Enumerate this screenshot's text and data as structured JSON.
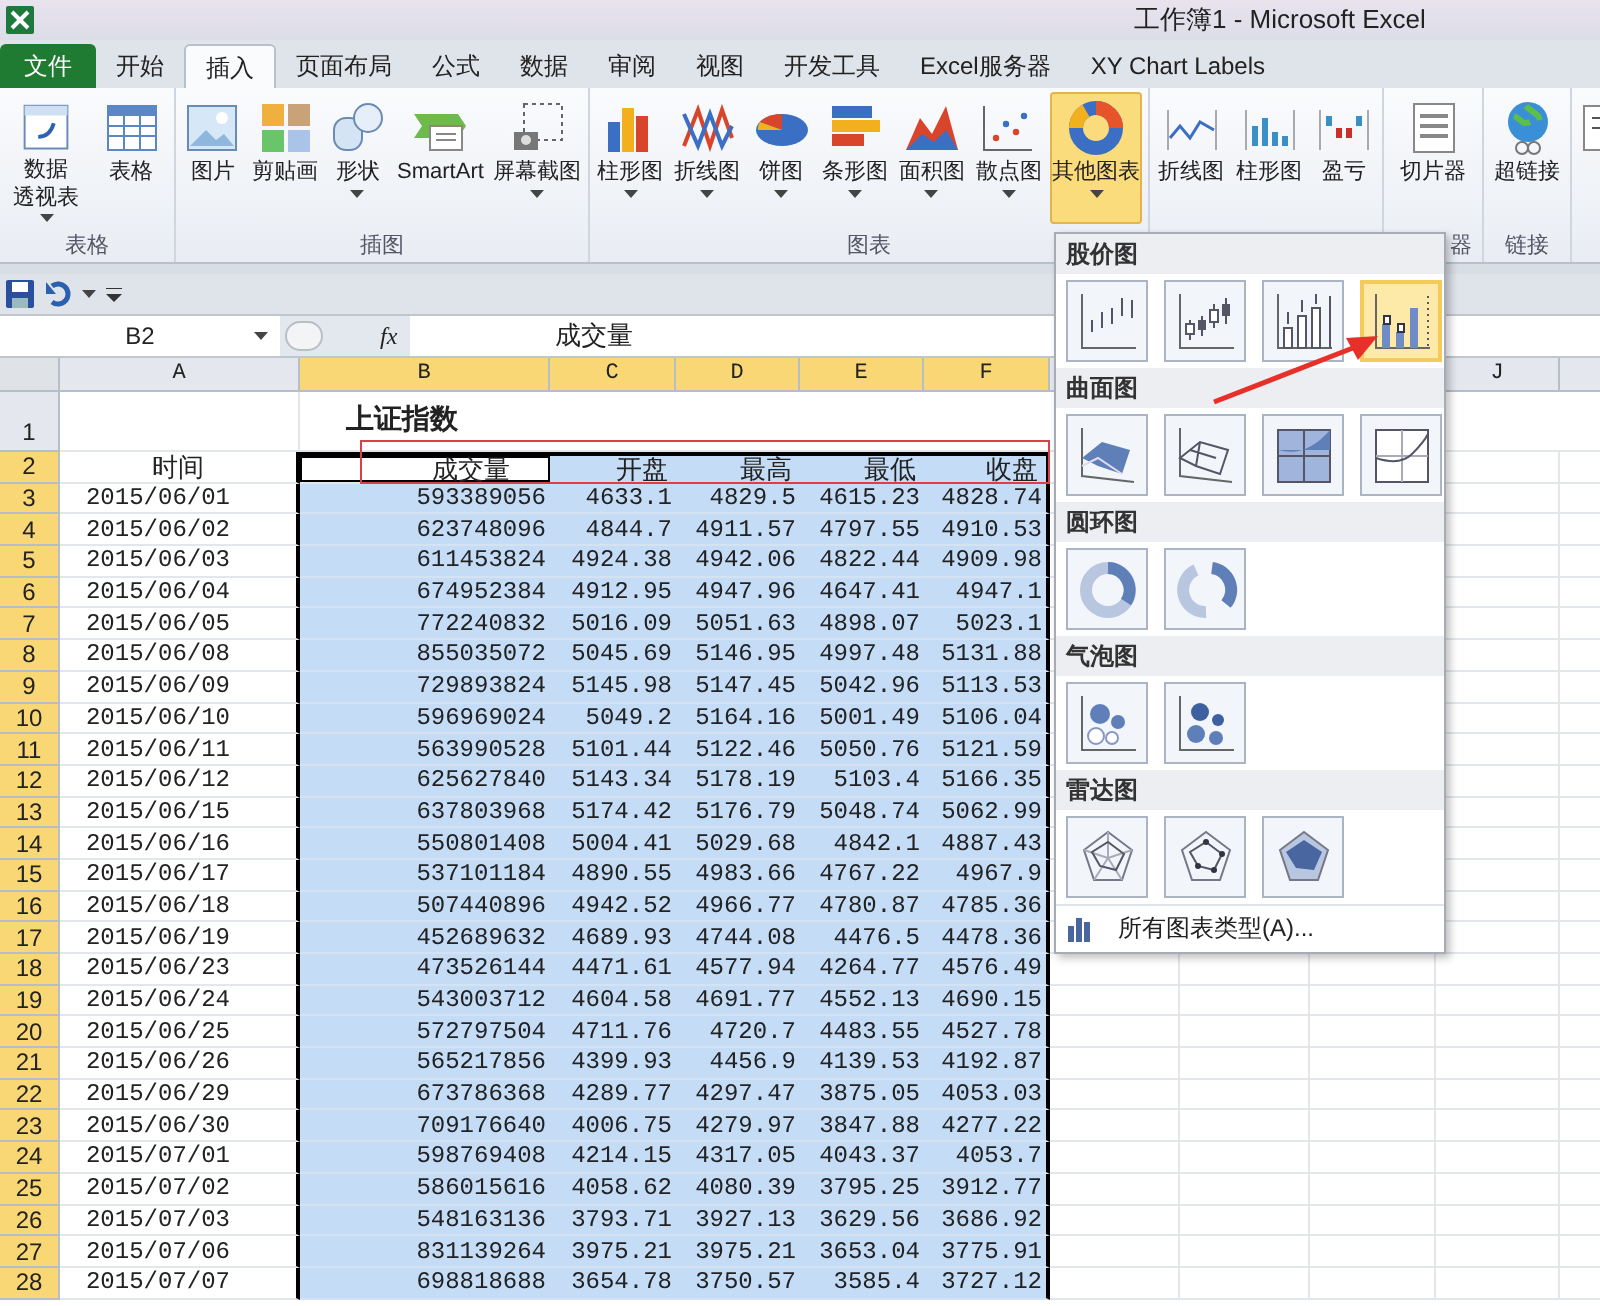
{
  "window": {
    "title": "工作簿1 - Microsoft Excel"
  },
  "tabs": [
    {
      "label": "文件",
      "kind": "file",
      "selected": false
    },
    {
      "label": "开始",
      "kind": "tab",
      "selected": false
    },
    {
      "label": "插入",
      "kind": "tab",
      "selected": true
    },
    {
      "label": "页面布局",
      "kind": "tab",
      "selected": false
    },
    {
      "label": "公式",
      "kind": "tab",
      "selected": false
    },
    {
      "label": "数据",
      "kind": "tab",
      "selected": false
    },
    {
      "label": "审阅",
      "kind": "tab",
      "selected": false
    },
    {
      "label": "视图",
      "kind": "tab",
      "selected": false
    },
    {
      "label": "开发工具",
      "kind": "tab",
      "selected": false
    },
    {
      "label": "Excel服务器",
      "kind": "tab",
      "selected": false
    },
    {
      "label": "XY Chart Labels",
      "kind": "tab",
      "selected": false
    }
  ],
  "ribbon": {
    "groups": [
      {
        "label": "表格",
        "buttons": [
          {
            "lines": [
              "数据",
              "透视表"
            ],
            "menu": true,
            "selected": false
          },
          {
            "label": "表格",
            "menu": false,
            "selected": false
          }
        ]
      },
      {
        "label": "插图",
        "buttons": [
          {
            "label": "图片",
            "menu": false,
            "selected": false
          },
          {
            "label": "剪贴画",
            "menu": false,
            "selected": false
          },
          {
            "label": "形状",
            "menu": true,
            "selected": false
          },
          {
            "label": "SmartArt",
            "menu": false,
            "selected": false
          },
          {
            "label": "屏幕截图",
            "menu": true,
            "selected": false
          }
        ]
      },
      {
        "label": "图表",
        "buttons": [
          {
            "label": "柱形图",
            "menu": true,
            "selected": false
          },
          {
            "label": "折线图",
            "menu": true,
            "selected": false
          },
          {
            "label": "饼图",
            "menu": true,
            "selected": false
          },
          {
            "label": "条形图",
            "menu": true,
            "selected": false
          },
          {
            "label": "面积图",
            "menu": true,
            "selected": false
          },
          {
            "label": "散点图",
            "menu": true,
            "selected": false
          },
          {
            "label": "其他图表",
            "menu": true,
            "selected": true
          }
        ]
      },
      {
        "buttons": [
          {
            "label": "折线图",
            "menu": false,
            "selected": false
          },
          {
            "label": "柱形图",
            "menu": false,
            "selected": false
          },
          {
            "label": "盈亏",
            "menu": false,
            "selected": false
          }
        ]
      },
      {
        "label": "器",
        "buttons": [
          {
            "label": "切片器",
            "menu": false,
            "selected": false
          }
        ]
      },
      {
        "label": "链接",
        "buttons": [
          {
            "label": "超链接",
            "menu": false,
            "selected": false
          }
        ]
      },
      {
        "buttons": [
          {
            "selected": false
          }
        ]
      }
    ]
  },
  "formula_bar": {
    "name_box": "B2",
    "fx": "fx",
    "value": "成交量"
  },
  "sheet": {
    "columns": [
      {
        "label": "A",
        "selected": false
      },
      {
        "label": "B",
        "selected": true
      },
      {
        "label": "C",
        "selected": true
      },
      {
        "label": "D",
        "selected": true
      },
      {
        "label": "E",
        "selected": true
      },
      {
        "label": "F",
        "selected": true
      }
    ],
    "far_column": "J",
    "title_row": {
      "row": "1",
      "title": "上证指数",
      "selected": false
    },
    "header_row": {
      "row": "2",
      "selected": true,
      "cells": [
        {
          "text": "时间",
          "active": false
        },
        {
          "text": "成交量",
          "active": true
        },
        {
          "text": "开盘",
          "active": false
        },
        {
          "text": "最高",
          "active": false
        },
        {
          "text": "最低",
          "active": false
        },
        {
          "text": "收盘",
          "active": false
        }
      ]
    },
    "rows": [
      {
        "row": "3",
        "selected": true,
        "cells": [
          "2015/06/01",
          "593389056",
          "4633.1",
          "4829.5",
          "4615.23",
          "4828.74"
        ]
      },
      {
        "row": "4",
        "selected": true,
        "cells": [
          "2015/06/02",
          "623748096",
          "4844.7",
          "4911.57",
          "4797.55",
          "4910.53"
        ]
      },
      {
        "row": "5",
        "selected": true,
        "cells": [
          "2015/06/03",
          "611453824",
          "4924.38",
          "4942.06",
          "4822.44",
          "4909.98"
        ]
      },
      {
        "row": "6",
        "selected": true,
        "cells": [
          "2015/06/04",
          "674952384",
          "4912.95",
          "4947.96",
          "4647.41",
          "4947.1"
        ]
      },
      {
        "row": "7",
        "selected": true,
        "cells": [
          "2015/06/05",
          "772240832",
          "5016.09",
          "5051.63",
          "4898.07",
          "5023.1"
        ]
      },
      {
        "row": "8",
        "selected": true,
        "cells": [
          "2015/06/08",
          "855035072",
          "5045.69",
          "5146.95",
          "4997.48",
          "5131.88"
        ]
      },
      {
        "row": "9",
        "selected": true,
        "cells": [
          "2015/06/09",
          "729893824",
          "5145.98",
          "5147.45",
          "5042.96",
          "5113.53"
        ]
      },
      {
        "row": "10",
        "selected": true,
        "cells": [
          "2015/06/10",
          "596969024",
          "5049.2",
          "5164.16",
          "5001.49",
          "5106.04"
        ]
      },
      {
        "row": "11",
        "selected": true,
        "cells": [
          "2015/06/11",
          "563990528",
          "5101.44",
          "5122.46",
          "5050.76",
          "5121.59"
        ]
      },
      {
        "row": "12",
        "selected": true,
        "cells": [
          "2015/06/12",
          "625627840",
          "5143.34",
          "5178.19",
          "5103.4",
          "5166.35"
        ]
      },
      {
        "row": "13",
        "selected": true,
        "cells": [
          "2015/06/15",
          "637803968",
          "5174.42",
          "5176.79",
          "5048.74",
          "5062.99"
        ]
      },
      {
        "row": "14",
        "selected": true,
        "cells": [
          "2015/06/16",
          "550801408",
          "5004.41",
          "5029.68",
          "4842.1",
          "4887.43"
        ]
      },
      {
        "row": "15",
        "selected": true,
        "cells": [
          "2015/06/17",
          "537101184",
          "4890.55",
          "4983.66",
          "4767.22",
          "4967.9"
        ]
      },
      {
        "row": "16",
        "selected": true,
        "cells": [
          "2015/06/18",
          "507440896",
          "4942.52",
          "4966.77",
          "4780.87",
          "4785.36"
        ]
      },
      {
        "row": "17",
        "selected": true,
        "cells": [
          "2015/06/19",
          "452689632",
          "4689.93",
          "4744.08",
          "4476.5",
          "4478.36"
        ]
      },
      {
        "row": "18",
        "selected": true,
        "cells": [
          "2015/06/23",
          "473526144",
          "4471.61",
          "4577.94",
          "4264.77",
          "4576.49"
        ]
      },
      {
        "row": "19",
        "selected": true,
        "cells": [
          "2015/06/24",
          "543003712",
          "4604.58",
          "4691.77",
          "4552.13",
          "4690.15"
        ]
      },
      {
        "row": "20",
        "selected": true,
        "cells": [
          "2015/06/25",
          "572797504",
          "4711.76",
          "4720.7",
          "4483.55",
          "4527.78"
        ]
      },
      {
        "row": "21",
        "selected": true,
        "cells": [
          "2015/06/26",
          "565217856",
          "4399.93",
          "4456.9",
          "4139.53",
          "4192.87"
        ]
      },
      {
        "row": "22",
        "selected": true,
        "cells": [
          "2015/06/29",
          "673786368",
          "4289.77",
          "4297.47",
          "3875.05",
          "4053.03"
        ]
      },
      {
        "row": "23",
        "selected": true,
        "cells": [
          "2015/06/30",
          "709176640",
          "4006.75",
          "4279.97",
          "3847.88",
          "4277.22"
        ]
      },
      {
        "row": "24",
        "selected": true,
        "cells": [
          "2015/07/01",
          "598769408",
          "4214.15",
          "4317.05",
          "4043.37",
          "4053.7"
        ]
      },
      {
        "row": "25",
        "selected": true,
        "cells": [
          "2015/07/02",
          "586015616",
          "4058.62",
          "4080.39",
          "3795.25",
          "3912.77"
        ]
      },
      {
        "row": "26",
        "selected": true,
        "cells": [
          "2015/07/03",
          "548163136",
          "3793.71",
          "3927.13",
          "3629.56",
          "3686.92"
        ]
      },
      {
        "row": "27",
        "selected": true,
        "cells": [
          "2015/07/06",
          "831139264",
          "3975.21",
          "3975.21",
          "3653.04",
          "3775.91"
        ]
      },
      {
        "row": "28",
        "selected": true,
        "cells": [
          "2015/07/07",
          "698818688",
          "3654.78",
          "3750.57",
          "3585.4",
          "3727.12"
        ]
      }
    ]
  },
  "chart_menu": {
    "sections": [
      {
        "title": "股价图",
        "items": [
          {
            "selected": false
          },
          {
            "selected": false
          },
          {
            "selected": false
          },
          {
            "selected": true
          }
        ]
      },
      {
        "title": "曲面图",
        "items": [
          {
            "selected": false
          },
          {
            "selected": false
          },
          {
            "selected": false
          },
          {
            "selected": false
          }
        ]
      },
      {
        "title": "圆环图",
        "items": [
          {
            "selected": false
          },
          {
            "selected": false
          }
        ]
      },
      {
        "title": "气泡图",
        "items": [
          {
            "selected": false
          },
          {
            "selected": false
          }
        ]
      },
      {
        "title": "雷达图",
        "items": [
          {
            "selected": false
          },
          {
            "selected": false
          },
          {
            "selected": false
          }
        ]
      }
    ],
    "footer": "所有图表类型(A)..."
  }
}
